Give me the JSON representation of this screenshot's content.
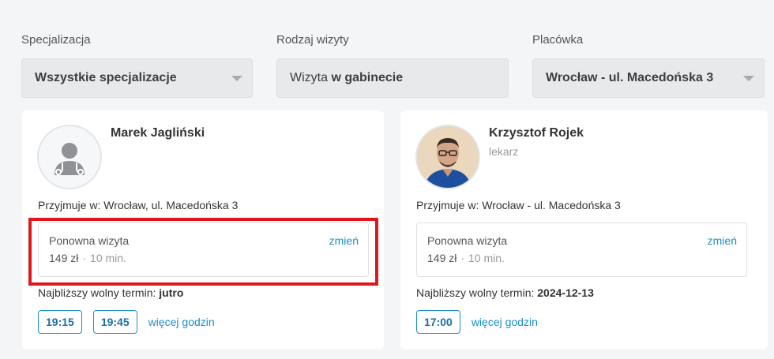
{
  "filters": [
    {
      "label": "Specjalizacja",
      "value": "Wszystkie specjalizacje"
    },
    {
      "label": "Rodzaj wizyty",
      "value_prefix": "Wizyta ",
      "value_bold": "w gabinecie"
    },
    {
      "label": "Placówka",
      "value": "Wrocław - ul. Macedońska 3"
    }
  ],
  "doctors": [
    {
      "name": "Marek Jagliński",
      "accepts": "Przyjmuje w: Wrocław, ul. Macedońska 3",
      "visit_type": "Ponowna wizyta",
      "change": "zmień",
      "price": "149 zł",
      "sep": "·",
      "duration": "10 min.",
      "next_label": "Najbliższy wolny termin:",
      "next_value": "jutro",
      "slots": [
        "19:15",
        "19:45"
      ],
      "more": "więcej godzin"
    },
    {
      "name": "Krzysztof Rojek",
      "role": "lekarz",
      "accepts": "Przyjmuje w: Wrocław - ul. Macedońska 3",
      "visit_type": "Ponowna wizyta",
      "change": "zmień",
      "price": "149 zł",
      "sep": "·",
      "duration": "10 min.",
      "next_label": "Najbliższy wolny termin:",
      "next_value": "2024-12-13",
      "slots": [
        "17:00"
      ],
      "more": "więcej godzin"
    }
  ],
  "colors": {
    "link": "#1a8fc9",
    "highlight": "#e0161c",
    "avatar_bg": "#f0f1f2"
  },
  "icons": {
    "placeholder_avatar": "doctor-silhouette-icon",
    "select_arrow": "chevron-down-icon"
  }
}
